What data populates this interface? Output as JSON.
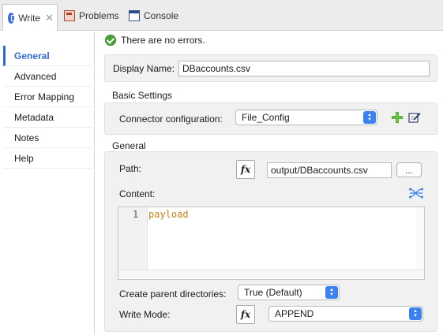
{
  "tabs": [
    {
      "label": "Write",
      "icon": "write-icon",
      "active": true,
      "closable": true
    },
    {
      "label": "Problems",
      "icon": "problems-icon",
      "active": false
    },
    {
      "label": "Console",
      "icon": "console-icon",
      "active": false
    }
  ],
  "tab_close_glyph": "✕",
  "sidebar": {
    "items": [
      {
        "label": "General",
        "active": true
      },
      {
        "label": "Advanced"
      },
      {
        "label": "Error Mapping"
      },
      {
        "label": "Metadata"
      },
      {
        "label": "Notes"
      },
      {
        "label": "Help"
      }
    ]
  },
  "status": {
    "message": "There are no errors.",
    "icon": "check-circle-icon"
  },
  "display_name": {
    "label": "Display Name:",
    "value": "DBaccounts.csv"
  },
  "basic_settings": {
    "title": "Basic Settings",
    "connector_label": "Connector configuration:",
    "connector_value": "File_Config"
  },
  "general": {
    "title": "General",
    "path_label": "Path:",
    "path_value": "output/DBaccounts.csv",
    "browse_label": "...",
    "content_label": "Content:",
    "editor_line_number": "1",
    "editor_code": "payload",
    "create_parent_label": "Create parent directories:",
    "create_parent_value": "True (Default)",
    "write_mode_label": "Write Mode:",
    "write_mode_value": "APPEND"
  },
  "fx_label": "fx",
  "colors": {
    "accent": "#2f6bd8",
    "success": "#4aa532",
    "code": "#c8841c",
    "select_arrow": "#3b82f0"
  }
}
